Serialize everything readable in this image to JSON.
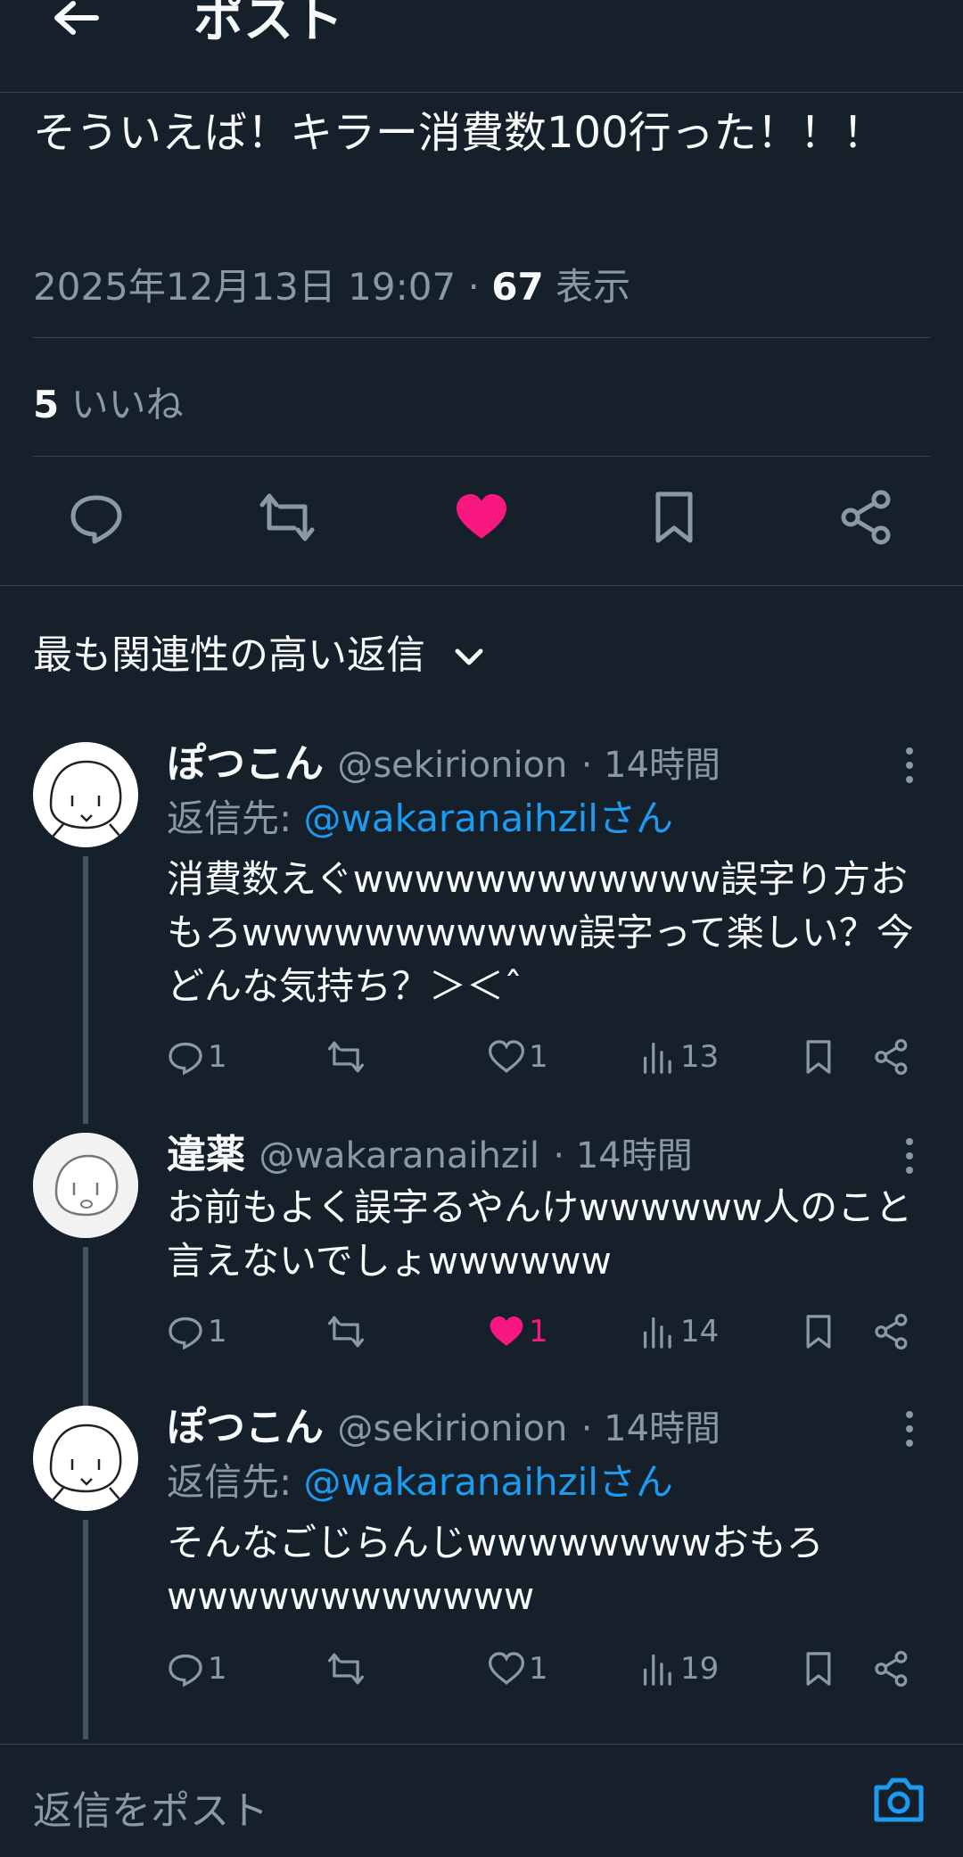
{
  "header": {
    "title": "ポスト"
  },
  "post": {
    "text": "そういえば！キラー消費数100行った！！！",
    "datetime": "2025年12月13日 19:07",
    "views_count": "67",
    "views_label": "表示",
    "likes_count": "5",
    "likes_label": "いいね"
  },
  "sort": {
    "label": "最も関連性の高い返信"
  },
  "replies": [
    {
      "display_name": "ぽつこん",
      "handle": "@sekirionion",
      "time": "14時間",
      "reply_to_prefix": "返信先: ",
      "reply_to": "@wakaranaihzilさん",
      "text": "消費数えぐwwwwwwwwwwww誤字り方おもろwwwwwwwwwww誤字って楽しい？今どんな気持ち？＞＜ˆ",
      "replies": "1",
      "likes": "1",
      "views": "13",
      "liked": false
    },
    {
      "display_name": "違薬",
      "handle": "@wakaranaihzil",
      "time": "14時間",
      "text": "お前もよく誤字るやんけwwwwww人のこと言えないでしょwwwwww",
      "replies": "1",
      "likes": "1",
      "views": "14",
      "liked": true
    },
    {
      "display_name": "ぽつこん",
      "handle": "@sekirionion",
      "time": "14時間",
      "reply_to_prefix": "返信先: ",
      "reply_to": "@wakaranaihzilさん",
      "text": "そんなごじらんじwwwwwwwwおもろwwwwwwwwwwww",
      "replies": "1",
      "likes": "1",
      "views": "19",
      "liked": false
    }
  ],
  "composer": {
    "placeholder": "返信をポスト"
  },
  "colors": {
    "background": "#15202b",
    "accent": "#1d9bf0",
    "like": "#f91880",
    "muted": "#8b98a5"
  }
}
